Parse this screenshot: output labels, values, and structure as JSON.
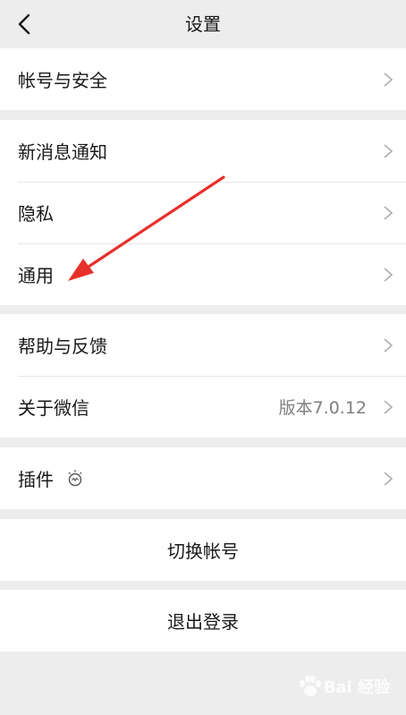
{
  "header": {
    "title": "设置",
    "back_icon": "chevron-left-icon"
  },
  "groups": {
    "account": {
      "label": "帐号与安全"
    },
    "notifications": {
      "label": "新消息通知"
    },
    "privacy": {
      "label": "隐私"
    },
    "general": {
      "label": "通用"
    },
    "help": {
      "label": "帮助与反馈"
    },
    "about": {
      "label": "关于微信",
      "value": "版本7.0.12"
    },
    "plugins": {
      "label": "插件",
      "icon": "lightbulb-icon"
    }
  },
  "actions": {
    "switch_account": "切换帐号",
    "logout": "退出登录"
  },
  "annotation": {
    "arrow_color": "#e8302a"
  },
  "watermark": {
    "text": "Bai 经验"
  }
}
